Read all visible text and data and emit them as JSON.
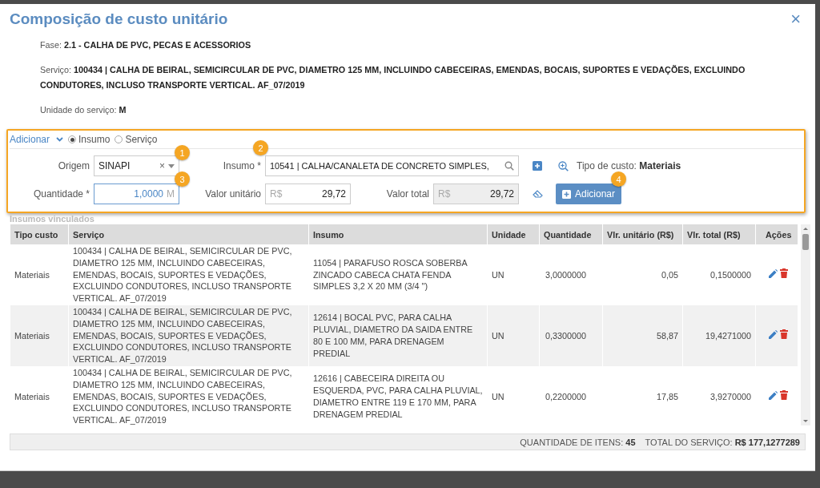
{
  "window": {
    "title": "Composição de custo unitário",
    "close": "×"
  },
  "info": [
    {
      "label": "Fase:",
      "value": "2.1 - CALHA DE PVC, PECAS E ACESSORIOS"
    },
    {
      "label": "Serviço:",
      "value": "100434 | CALHA DE BEIRAL, SEMICIRCULAR DE PVC, DIAMETRO 125 MM, INCLUINDO CABECEIRAS, EMENDAS, BOCAIS, SUPORTES E VEDAÇÕES, EXCLUINDO CONDUTORES, INCLUSO TRANSPORTE VERTICAL. AF_07/2019"
    },
    {
      "label": "Unidade do serviço:",
      "value": "M"
    }
  ],
  "add_form": {
    "toggle_label": "Adicionar",
    "expanded": true,
    "modes": [
      {
        "label": "Insumo",
        "selected": true
      },
      {
        "label": "Serviço",
        "selected": false
      }
    ],
    "origem": {
      "label": "Origem",
      "value": "SINAPI",
      "clear": "×"
    },
    "insumo": {
      "label": "Insumo *",
      "value": "10541 | CALHA/CANALETA DE CONCRETO SIMPLES,"
    },
    "tipo_custo": {
      "label": "Tipo de custo:",
      "value": "Materiais"
    },
    "quantidade": {
      "label": "Quantidade *",
      "value": "1,0000",
      "unit": "M"
    },
    "valor_unitario": {
      "label": "Valor unitário",
      "currency": "R$",
      "value": "29,72",
      "disabled": false
    },
    "valor_total": {
      "label": "Valor total",
      "currency": "R$",
      "value": "29,72",
      "disabled": true
    },
    "button": "Adicionar"
  },
  "callouts": [
    "1",
    "2",
    "3",
    "4"
  ],
  "section_title": "Insumos vinculados",
  "table": {
    "columns": [
      "Tipo custo",
      "Serviço",
      "Insumo",
      "Unidade",
      "Quantidade",
      "Vlr. unitário (R$)",
      "Vlr. total (R$)",
      "Ações"
    ],
    "rows": [
      {
        "cells": [
          "Materiais",
          "100434 | CALHA DE BEIRAL, SEMICIRCULAR DE PVC, DIAMETRO 125 MM, INCLUINDO CABECEIRAS, EMENDAS, BOCAIS, SUPORTES E VEDAÇÕES, EXCLUINDO CONDUTORES, INCLUSO TRANSPORTE VERTICAL. AF_07/2019",
          "11054 | PARAFUSO ROSCA SOBERBA ZINCADO CABECA CHATA FENDA SIMPLES 3,2 X 20 MM (3/4 \")",
          "UN",
          "3,0000000",
          "0,05",
          "0,1500000"
        ]
      },
      {
        "cells": [
          "Materiais",
          "100434 | CALHA DE BEIRAL, SEMICIRCULAR DE PVC, DIAMETRO 125 MM, INCLUINDO CABECEIRAS, EMENDAS, BOCAIS, SUPORTES E VEDAÇÕES, EXCLUINDO CONDUTORES, INCLUSO TRANSPORTE VERTICAL. AF_07/2019",
          "12614 | BOCAL PVC, PARA CALHA PLUVIAL, DIAMETRO DA SAIDA ENTRE 80 E 100 MM, PARA DRENAGEM PREDIAL",
          "UN",
          "0,3300000",
          "58,87",
          "19,4271000"
        ]
      },
      {
        "cells": [
          "Materiais",
          "100434 | CALHA DE BEIRAL, SEMICIRCULAR DE PVC, DIAMETRO 125 MM, INCLUINDO CABECEIRAS, EMENDAS, BOCAIS, SUPORTES E VEDAÇÕES, EXCLUINDO CONDUTORES, INCLUSO TRANSPORTE VERTICAL. AF_07/2019",
          "12616 | CABECEIRA DIREITA OU ESQUERDA, PVC, PARA CALHA PLUVIAL, DIAMETRO ENTRE 119 E 170 MM, PARA DRENAGEM PREDIAL",
          "UN",
          "0,2200000",
          "17,85",
          "3,9270000"
        ]
      }
    ]
  },
  "status_bar": {
    "items_label": "QUANTIDADE DE ITENS:",
    "items_value": "45",
    "total_label": "TOTAL DO SERVIÇO:",
    "total_value": "R$ 177,1277289"
  }
}
